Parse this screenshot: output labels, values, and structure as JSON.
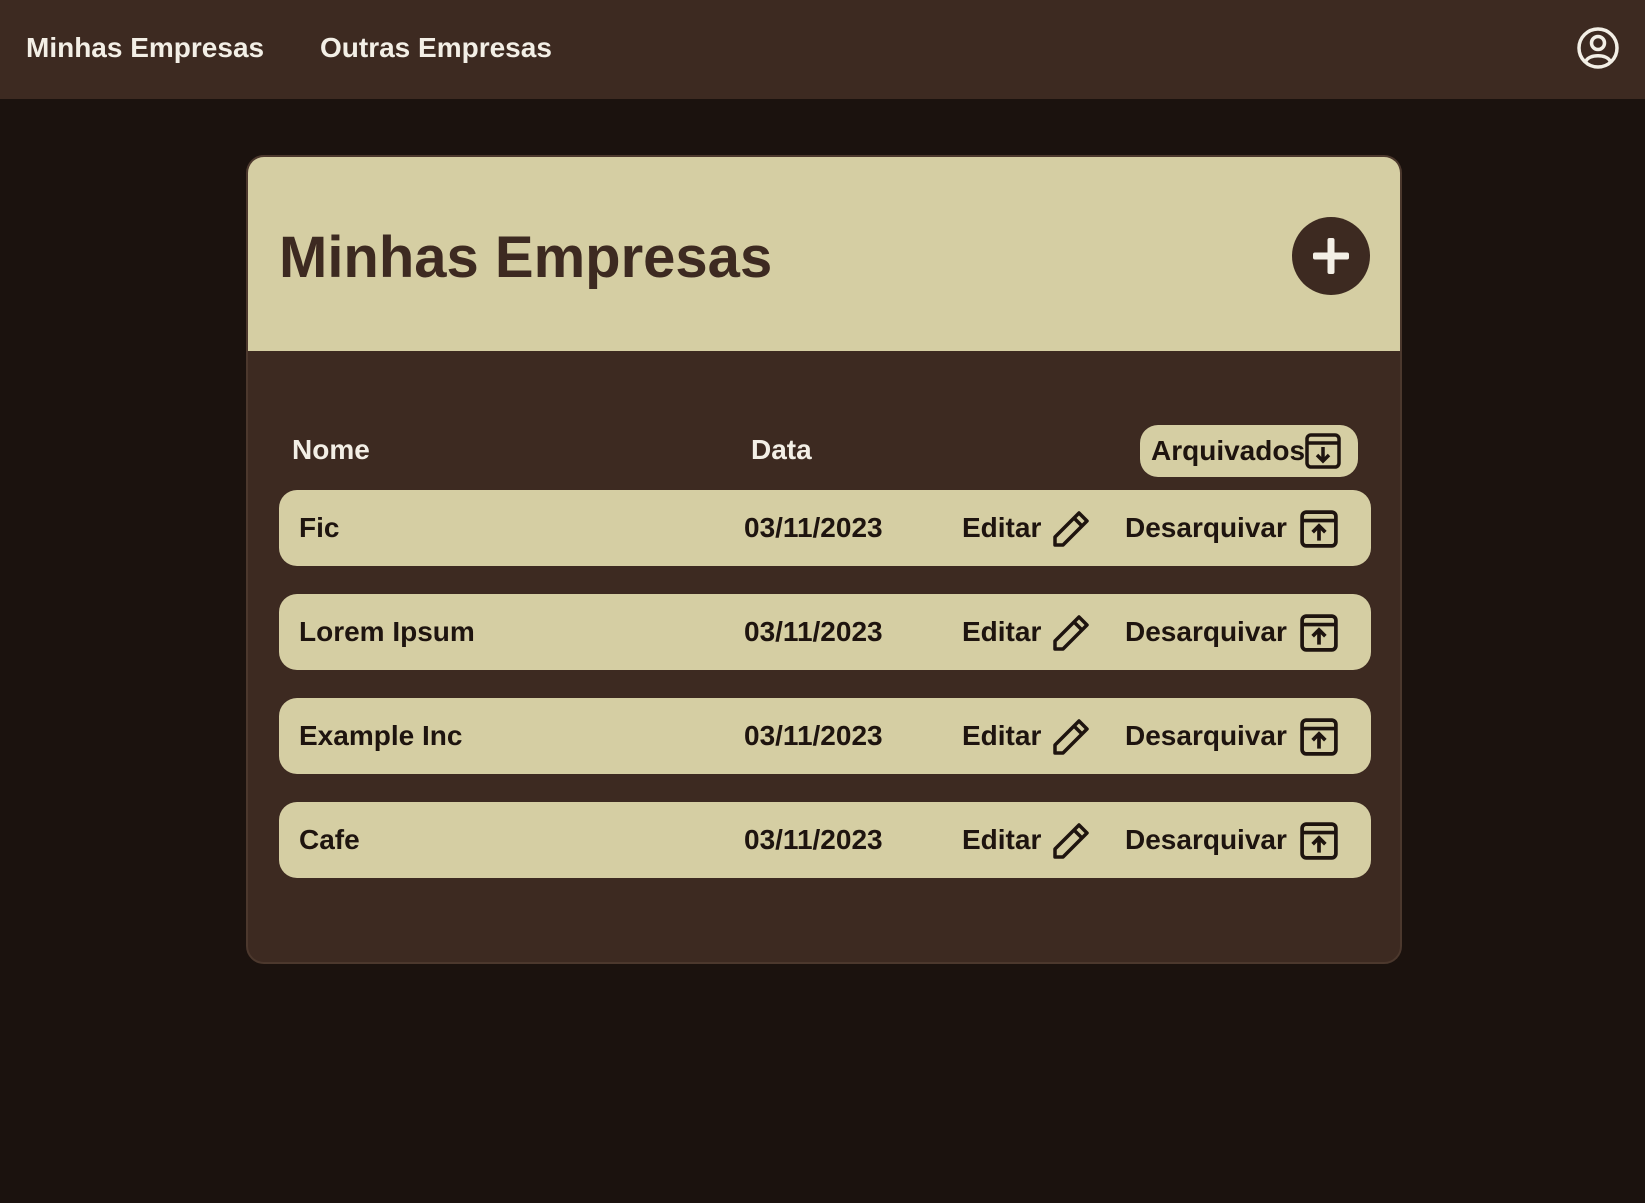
{
  "nav": {
    "links": [
      {
        "label": "Minhas Empresas"
      },
      {
        "label": "Outras Empresas"
      }
    ],
    "profile_icon": "user-circle-icon"
  },
  "card": {
    "title": "Minhas Empresas",
    "add_icon": "plus-icon"
  },
  "table": {
    "headers": {
      "name": "Nome",
      "date": "Data"
    },
    "archived_button": {
      "label": "Arquivados",
      "icon": "archive-down-icon"
    },
    "edit_label": "Editar",
    "unarchive_label": "Desarquivar",
    "rows": [
      {
        "name": "Fic",
        "date": "03/11/2023"
      },
      {
        "name": "Lorem Ipsum",
        "date": "03/11/2023"
      },
      {
        "name": "Example Inc",
        "date": "03/11/2023"
      },
      {
        "name": "Cafe",
        "date": "03/11/2023"
      }
    ]
  },
  "colors": {
    "page_background": "#1b120e",
    "topbar": "#3d2a21",
    "card_body": "#3d2a21",
    "beige": "#d5cea3",
    "text_dark": "#1e140f",
    "text_light": "#f3efe6"
  }
}
